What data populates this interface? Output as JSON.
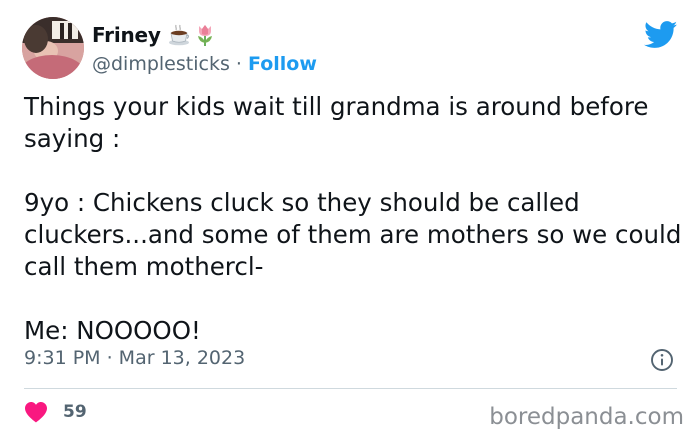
{
  "author": {
    "display_name": "Friney",
    "emojis": [
      "coffee-icon",
      "tulip-icon"
    ],
    "handle": "@dimplesticks",
    "separator": " · ",
    "follow_label": "Follow"
  },
  "tweet": {
    "text": "Things your kids wait till grandma is around before saying :\n\n9yo : Chickens cluck so they should be called cluckers...and some of them are mothers so we could call them mothercl-\n\nMe: NOOOOO!",
    "timestamp": "9:31 PM · Mar 13, 2023"
  },
  "engagement": {
    "like_count": "59"
  },
  "watermark": "boredpanda.com",
  "colors": {
    "link": "#1d9bf0",
    "secondary_text": "#536471",
    "heart": "#f91880",
    "divider": "#cfd9de"
  }
}
